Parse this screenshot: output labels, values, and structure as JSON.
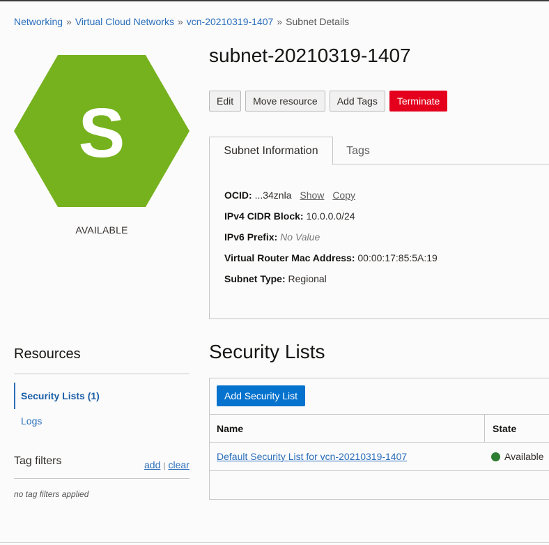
{
  "breadcrumb": {
    "items": [
      "Networking",
      "Virtual Cloud Networks",
      "vcn-20210319-1407"
    ],
    "separator": "»",
    "current": "Subnet Details"
  },
  "badge": {
    "letter": "S",
    "color": "#76b21e",
    "status": "AVAILABLE"
  },
  "header": {
    "title": "subnet-20210319-1407"
  },
  "actions": {
    "edit": "Edit",
    "move": "Move resource",
    "add_tags": "Add Tags",
    "terminate": "Terminate"
  },
  "tabs": [
    {
      "label": "Subnet Information",
      "active": true
    },
    {
      "label": "Tags",
      "active": false
    }
  ],
  "info": {
    "ocid_label": "OCID:",
    "ocid_value": "...34znla",
    "show": "Show",
    "copy": "Copy",
    "ipv4_label": "IPv4 CIDR Block:",
    "ipv4_value": "10.0.0.0/24",
    "ipv6_label": "IPv6 Prefix:",
    "ipv6_value": "No Value",
    "mac_label": "Virtual Router Mac Address:",
    "mac_value": "00:00:17:85:5A:19",
    "type_label": "Subnet Type:",
    "type_value": "Regional"
  },
  "resources": {
    "title": "Resources",
    "items": [
      "Security Lists (1)",
      "Logs"
    ]
  },
  "tag_filters": {
    "title": "Tag filters",
    "add": "add",
    "pipe": "|",
    "clear": "clear",
    "empty": "no tag filters applied"
  },
  "security_lists": {
    "title": "Security Lists",
    "add_button": "Add Security List",
    "columns": [
      "Name",
      "State"
    ],
    "rows": [
      {
        "name": "Default Security List for vcn-20210319-1407",
        "state": "Available",
        "state_color": "#2d7d32"
      }
    ]
  },
  "colors": {
    "link": "#2a6ebb",
    "danger": "#e4001d",
    "primary": "#0572ce"
  }
}
